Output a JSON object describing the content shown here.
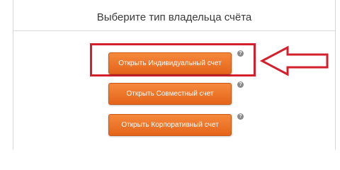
{
  "dialog": {
    "title": "Выберите тип владельца счёта"
  },
  "buttons": {
    "individual": "Открыть Индивидуальный счет",
    "joint": "Открыть Совместный счет",
    "corporate": "Открыть Корпоративный счет"
  },
  "help": {
    "symbol": "?"
  },
  "colors": {
    "button_top": "#f6893c",
    "button_bottom": "#e4641a",
    "highlight": "#d3202c",
    "help_bg": "#8a8a8a"
  }
}
